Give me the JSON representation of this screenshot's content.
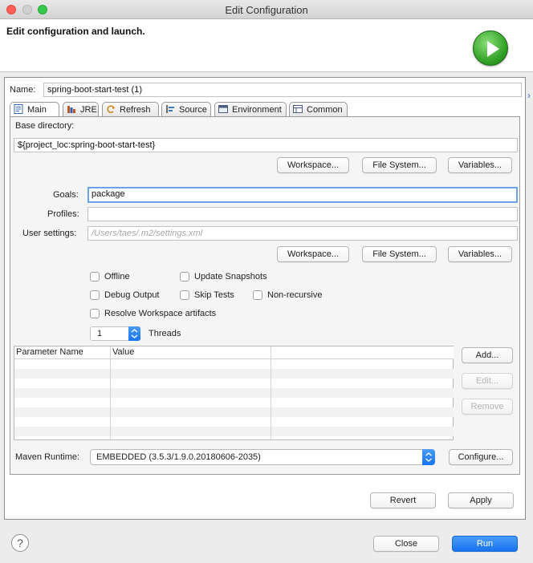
{
  "window": {
    "title": "Edit Configuration"
  },
  "header": {
    "title": "Edit configuration and launch."
  },
  "name_row": {
    "label": "Name:",
    "value": "spring-boot-start-test (1)"
  },
  "tabs": [
    {
      "label": "Main",
      "icon": "main-tab-icon",
      "active": true
    },
    {
      "label": "JRE",
      "icon": "jre-icon",
      "active": false
    },
    {
      "label": "Refresh",
      "icon": "refresh-icon",
      "active": false
    },
    {
      "label": "Source",
      "icon": "source-icon",
      "active": false
    },
    {
      "label": "Environment",
      "icon": "environment-icon",
      "active": false
    },
    {
      "label": "Common",
      "icon": "common-icon",
      "active": false
    }
  ],
  "main": {
    "base_dir": {
      "label": "Base directory:",
      "value": "${project_loc:spring-boot-start-test}"
    },
    "base_dir_buttons": [
      "Workspace...",
      "File System...",
      "Variables..."
    ],
    "goals": {
      "label": "Goals:",
      "value": "package"
    },
    "profiles": {
      "label": "Profiles:",
      "value": ""
    },
    "user_settings": {
      "label": "User settings:",
      "placeholder": "/Users/taes/.m2/settings.xml"
    },
    "settings_buttons": [
      "Workspace...",
      "File System...",
      "Variables..."
    ],
    "checkboxes": {
      "offline": "Offline",
      "update_snapshots": "Update Snapshots",
      "debug_output": "Debug Output",
      "skip_tests": "Skip Tests",
      "non_recursive": "Non-recursive",
      "resolve_workspace": "Resolve Workspace artifacts"
    },
    "threads": {
      "value": "1",
      "label": "Threads"
    },
    "param_table": {
      "columns": [
        "Parameter Name",
        "Value"
      ]
    },
    "param_buttons": {
      "add": "Add...",
      "edit": "Edit...",
      "remove": "Remove"
    },
    "runtime": {
      "label": "Maven Runtime:",
      "value": "EMBEDDED (3.5.3/1.9.0.20180606-2035)",
      "configure": "Configure..."
    }
  },
  "actions": {
    "revert": "Revert",
    "apply": "Apply"
  },
  "footer": {
    "close": "Close",
    "run": "Run",
    "help": "?"
  },
  "colors": {
    "accent": "#1874ef",
    "run_badge": "#2f9e24",
    "focus": "#6aa3e8"
  }
}
